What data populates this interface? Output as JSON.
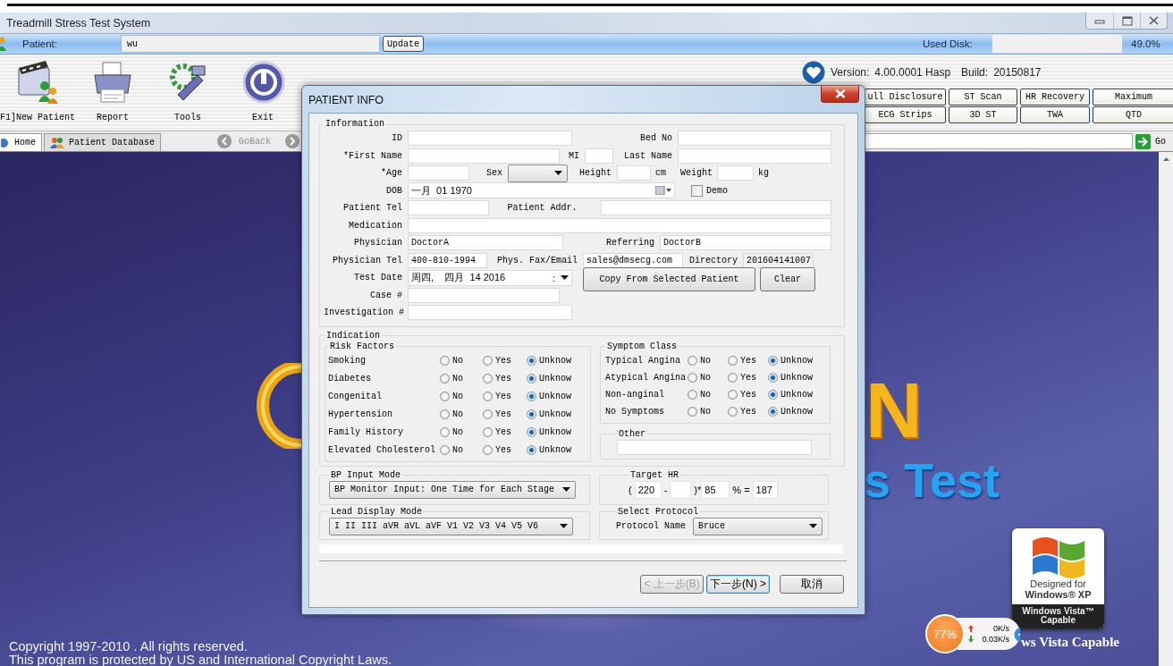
{
  "window": {
    "title": "Treadmill Stress Test System"
  },
  "patient_bar": {
    "label": "Patient:",
    "value": "wu",
    "update": "Update",
    "disk_label": "Used Disk:",
    "disk_reading": "49.0%"
  },
  "toolbar": {
    "items": [
      {
        "kind": "new-patient",
        "label": "F1]New Patient"
      },
      {
        "kind": "report",
        "label": "Report"
      },
      {
        "kind": "tools",
        "label": "Tools"
      },
      {
        "kind": "exit",
        "label": "Exit"
      }
    ],
    "version_label": "Version:",
    "version": "4.00.0001 Hasp",
    "build_label": "Build:",
    "build": "20150817",
    "function_buttons": [
      {
        "label": "ull Disclosure"
      },
      {
        "label": "ST Scan"
      },
      {
        "label": "HR Recovery"
      },
      {
        "label": "Maximum"
      },
      {
        "label": "ECG Strips"
      },
      {
        "label": "3D ST"
      },
      {
        "label": "TWA"
      },
      {
        "label": "QTD"
      }
    ]
  },
  "tabs": [
    {
      "label": "Home",
      "selected": true
    },
    {
      "label": "Patient Database",
      "selected": false
    }
  ],
  "nav": {
    "back": "GoBack",
    "go": "Go"
  },
  "splash": {
    "logo_letter": "N",
    "subtitle": "s Test",
    "badge": {
      "line1": "Designed for",
      "line2": "Windows® XP",
      "line3": "Windows Vista™",
      "line4": "Capable"
    },
    "caption": "ws Vista Capable",
    "copyright": [
      "Copyright 1997-2010 . All rights reserved.",
      "This program is protected by US and International Copyright Laws."
    ]
  },
  "network_widget": {
    "percent": "77%",
    "up": "0K/s",
    "down": "0.03K/s"
  },
  "dialog": {
    "title": "PATIENT INFO",
    "information": {
      "legend": "Information",
      "id": {
        "label": "ID"
      },
      "bed_no": {
        "label": "Bed No"
      },
      "first_name": {
        "label": "*First Name"
      },
      "mi": {
        "label": "MI"
      },
      "last_name": {
        "label": "Last Name"
      },
      "age": {
        "label": "*Age"
      },
      "sex": {
        "label": "Sex"
      },
      "height": {
        "label": "Height",
        "unit": "cm"
      },
      "weight": {
        "label": "Weight",
        "unit": "kg"
      },
      "dob": {
        "label": "DOB",
        "value": "一月  01 1970"
      },
      "demo": {
        "label": "Demo",
        "checked": false
      },
      "patient_tel": {
        "label": "Patient Tel"
      },
      "patient_addr": {
        "label": "Patient Addr."
      },
      "medication": {
        "label": "Medication"
      },
      "physician": {
        "label": "Physician",
        "value": "DoctorA"
      },
      "referring": {
        "label": "Referring",
        "value": "DoctorB"
      },
      "physician_tel": {
        "label": "Physician Tel",
        "value": "400-810-1994"
      },
      "fax_email": {
        "label": "Phys. Fax/Email",
        "value": "sales@dmsecg.com"
      },
      "directory": {
        "label": "Directory",
        "value": "201604141007"
      },
      "test_date": {
        "label": "Test Date",
        "value": "周四,    四月  14 2016",
        "separator": ":"
      },
      "case": {
        "label": "Case #"
      },
      "investigation": {
        "label": "Investigation #"
      },
      "copy_button": "Copy From Selected Patient",
      "clear_button": "Clear"
    },
    "indication": {
      "legend": "Indication",
      "risk_factors": {
        "legend": "Risk Factors",
        "rows": [
          {
            "label": "Smoking",
            "options": [
              {
                "label": "No",
                "selected": false
              },
              {
                "label": "Yes",
                "selected": false
              },
              {
                "label": "Unknow",
                "selected": true
              }
            ]
          },
          {
            "label": "Diabetes",
            "options": [
              {
                "label": "No",
                "selected": false
              },
              {
                "label": "Yes",
                "selected": false
              },
              {
                "label": "Unknow",
                "selected": true
              }
            ]
          },
          {
            "label": "Congenital",
            "options": [
              {
                "label": "No",
                "selected": false
              },
              {
                "label": "Yes",
                "selected": false
              },
              {
                "label": "Unknow",
                "selected": true
              }
            ]
          },
          {
            "label": "Hypertension",
            "options": [
              {
                "label": "No",
                "selected": false
              },
              {
                "label": "Yes",
                "selected": false
              },
              {
                "label": "Unknow",
                "selected": true
              }
            ]
          },
          {
            "label": "Family History",
            "options": [
              {
                "label": "No",
                "selected": false
              },
              {
                "label": "Yes",
                "selected": false
              },
              {
                "label": "Unknow",
                "selected": true
              }
            ]
          },
          {
            "label": "Elevated Cholesterol",
            "options": [
              {
                "label": "No",
                "selected": false
              },
              {
                "label": "Yes",
                "selected": false
              },
              {
                "label": "Unknow",
                "selected": true
              }
            ]
          }
        ]
      },
      "symptom_class": {
        "legend": "Symptom Class",
        "rows": [
          {
            "label": "Typical Angina",
            "options": [
              {
                "label": "No",
                "selected": false
              },
              {
                "label": "Yes",
                "selected": false
              },
              {
                "label": "Unknow",
                "selected": true
              }
            ]
          },
          {
            "label": "Atypical Angina",
            "options": [
              {
                "label": "No",
                "selected": false
              },
              {
                "label": "Yes",
                "selected": false
              },
              {
                "label": "Unknow",
                "selected": true
              }
            ]
          },
          {
            "label": "Non-anginal",
            "options": [
              {
                "label": "No",
                "selected": false
              },
              {
                "label": "Yes",
                "selected": false
              },
              {
                "label": "Unknow",
                "selected": true
              }
            ]
          },
          {
            "label": "No Symptoms",
            "options": [
              {
                "label": "No",
                "selected": false
              },
              {
                "label": "Yes",
                "selected": false
              },
              {
                "label": "Unknow",
                "selected": true
              }
            ]
          }
        ]
      },
      "other": {
        "legend": "Other"
      }
    },
    "bp_input_mode": {
      "legend": "BP Input Mode",
      "value": "BP Monitor Input: One Time for Each Stage"
    },
    "target_hr": {
      "legend": "Target HR",
      "open": "(",
      "base": "220",
      "minus": "-",
      "close": ")*",
      "percent": "85",
      "equals": "% =",
      "result": "187"
    },
    "lead_display_mode": {
      "legend": "Lead Display Mode",
      "value": "I II III aVR aVL aVF V1 V2 V3 V4 V5 V6"
    },
    "protocol": {
      "legend": "Select Protocol",
      "label": "Protocol Name",
      "value": "Bruce"
    },
    "buttons": [
      {
        "label": "< 上一步(B)",
        "disabled": true,
        "focused": false
      },
      {
        "label": "下一步(N) >",
        "disabled": false,
        "focused": true
      },
      {
        "label": "取消",
        "disabled": false,
        "focused": false
      }
    ]
  }
}
